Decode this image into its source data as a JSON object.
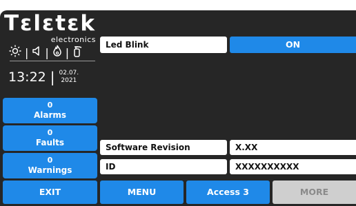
{
  "brand": {
    "name": "Tεlεtεk",
    "subtitle": "electronics"
  },
  "status_icons": [
    "sun-icon",
    "speaker-icon",
    "fire-icon",
    "extinguisher-icon"
  ],
  "clock": {
    "time": "13:22",
    "date_line1": "02.07.",
    "date_line2": "2021"
  },
  "side_buttons": {
    "alarms": {
      "count": "0",
      "label": "Alarms"
    },
    "faults": {
      "count": "0",
      "label": "Faults"
    },
    "warnings": {
      "count": "0",
      "label": "Warnings"
    }
  },
  "settings": {
    "led_blink": {
      "label": "Led Blink",
      "value": "ON"
    },
    "software_revision": {
      "label": "Software Revision",
      "value": "X.XX"
    },
    "id": {
      "label": "ID",
      "value": "XXXXXXXXXX"
    }
  },
  "bottom_bar": {
    "exit": "EXIT",
    "menu": "MENU",
    "access": "Access 3",
    "more": "MORE"
  },
  "colors": {
    "accent": "#1f89e8",
    "background": "#262626",
    "disabled": "#cfcfcf"
  }
}
